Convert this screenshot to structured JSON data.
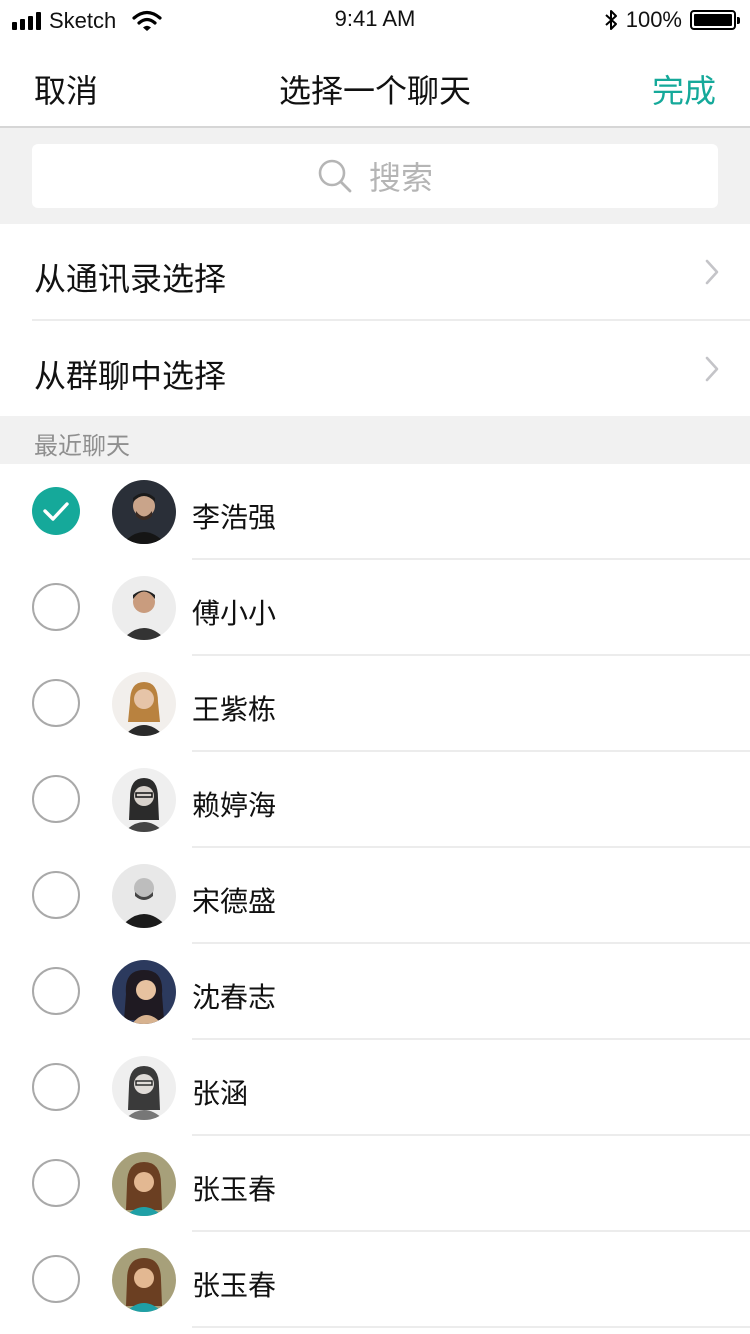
{
  "status_bar": {
    "carrier": "Sketch",
    "time": "9:41 AM",
    "battery": "100%",
    "battery_level": 1.0
  },
  "nav": {
    "cancel": "取消",
    "title": "选择一个聊天",
    "done": "完成"
  },
  "search": {
    "placeholder": "搜索"
  },
  "options": [
    {
      "label": "从通讯录选择"
    },
    {
      "label": "从群聊中选择"
    }
  ],
  "section": {
    "recent": "最近聊天"
  },
  "contacts": [
    {
      "name": "李浩强",
      "checked": true
    },
    {
      "name": "傅小小",
      "checked": false
    },
    {
      "name": "王紫栋",
      "checked": false
    },
    {
      "name": "赖婷海",
      "checked": false
    },
    {
      "name": "宋德盛",
      "checked": false
    },
    {
      "name": "沈春志",
      "checked": false
    },
    {
      "name": "张涵",
      "checked": false
    },
    {
      "name": "张玉春",
      "checked": false
    },
    {
      "name": "张玉春",
      "checked": false
    }
  ],
  "colors": {
    "accent": "#15a99a",
    "separator": "#ececec",
    "section_bg": "#f1f1f1"
  }
}
